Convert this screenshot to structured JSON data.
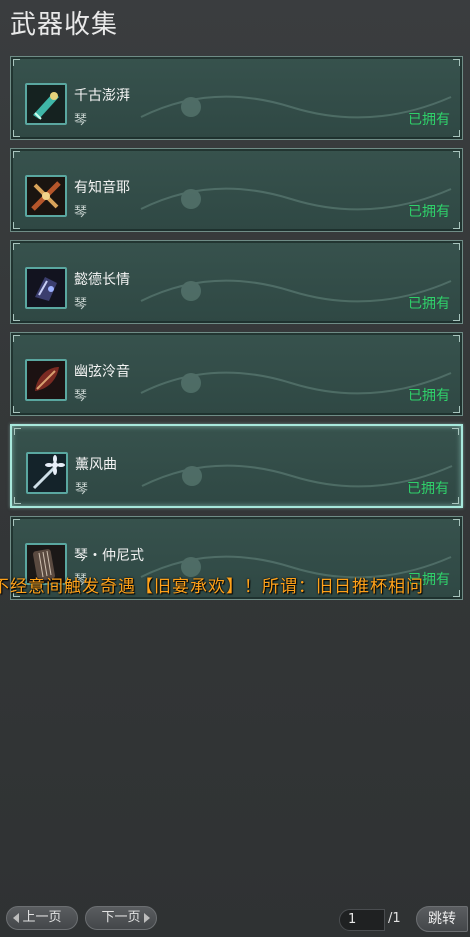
{
  "title": "武器收集",
  "items": [
    {
      "name": "千古澎湃",
      "type": "琴",
      "status": "已拥有",
      "icon": "jade-blade-icon"
    },
    {
      "name": "有知音耶",
      "type": "琴",
      "status": "已拥有",
      "icon": "crossed-sticks-icon"
    },
    {
      "name": "懿德长情",
      "type": "琴",
      "status": "已拥有",
      "icon": "dark-crystal-icon"
    },
    {
      "name": "幽弦泠音",
      "type": "琴",
      "status": "已拥有",
      "icon": "red-feather-icon"
    },
    {
      "name": "薰风曲",
      "type": "琴",
      "status": "已拥有",
      "icon": "flower-sword-icon"
    },
    {
      "name": "琴・仲尼式",
      "type": "琴",
      "status": "已拥有",
      "icon": "guqin-icon"
    }
  ],
  "marquee": "不经意间触发奇遇【旧宴承欢】！所谓：旧日推杯相问",
  "pager": {
    "prev_label": "上一页",
    "next_label": "下一页",
    "current_page": "1",
    "total_pages": "/1",
    "jump_label": "跳转"
  },
  "colors": {
    "owned": "#2fd06a",
    "marquee": "#ffa21a",
    "card_bg": "#37524d",
    "selected_border": "#a8e8dc"
  }
}
